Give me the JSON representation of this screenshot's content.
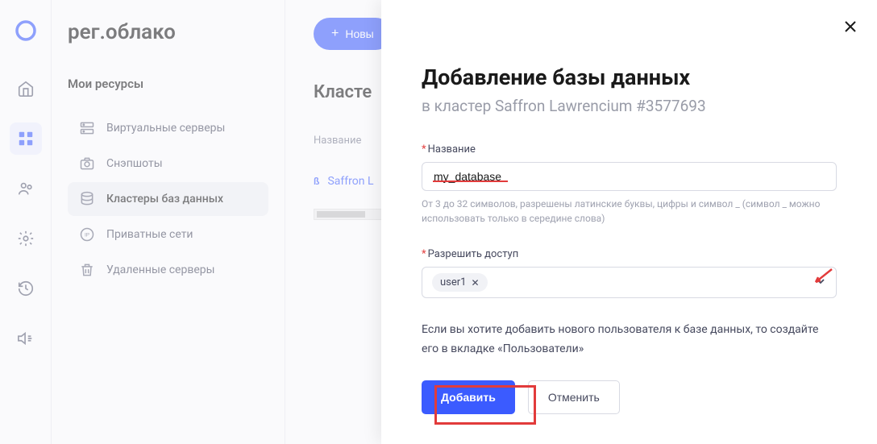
{
  "brand": "рег.облако",
  "sidebar": {
    "title": "Мои ресурсы",
    "items": [
      {
        "label": "Виртуальные серверы"
      },
      {
        "label": "Снэпшоты"
      },
      {
        "label": "Кластеры баз данных"
      },
      {
        "label": "Приватные сети"
      },
      {
        "label": "Удаленные серверы"
      }
    ]
  },
  "header": {
    "new_button": "Новы"
  },
  "main": {
    "title": "Класте",
    "table_header": "Название",
    "row_name": "Saffron L",
    "beta_badge": "ß"
  },
  "modal": {
    "title": "Добавление базы данных",
    "subtitle": "в кластер Saffron Lawrencium #3577693",
    "name_label": "Название",
    "name_value": "my_database",
    "name_hint": "От 3 до 32 символов, разрешены латинские буквы, цифры и символ _ (символ _ можно использовать только в середине слова)",
    "access_label": "Разрешить доступ",
    "access_chip": "user1",
    "info_text": "Если вы хотите добавить нового пользователя к базе данных, то создайте его в вкладке «Пользователи»",
    "submit": "Добавить",
    "cancel": "Отменить"
  }
}
